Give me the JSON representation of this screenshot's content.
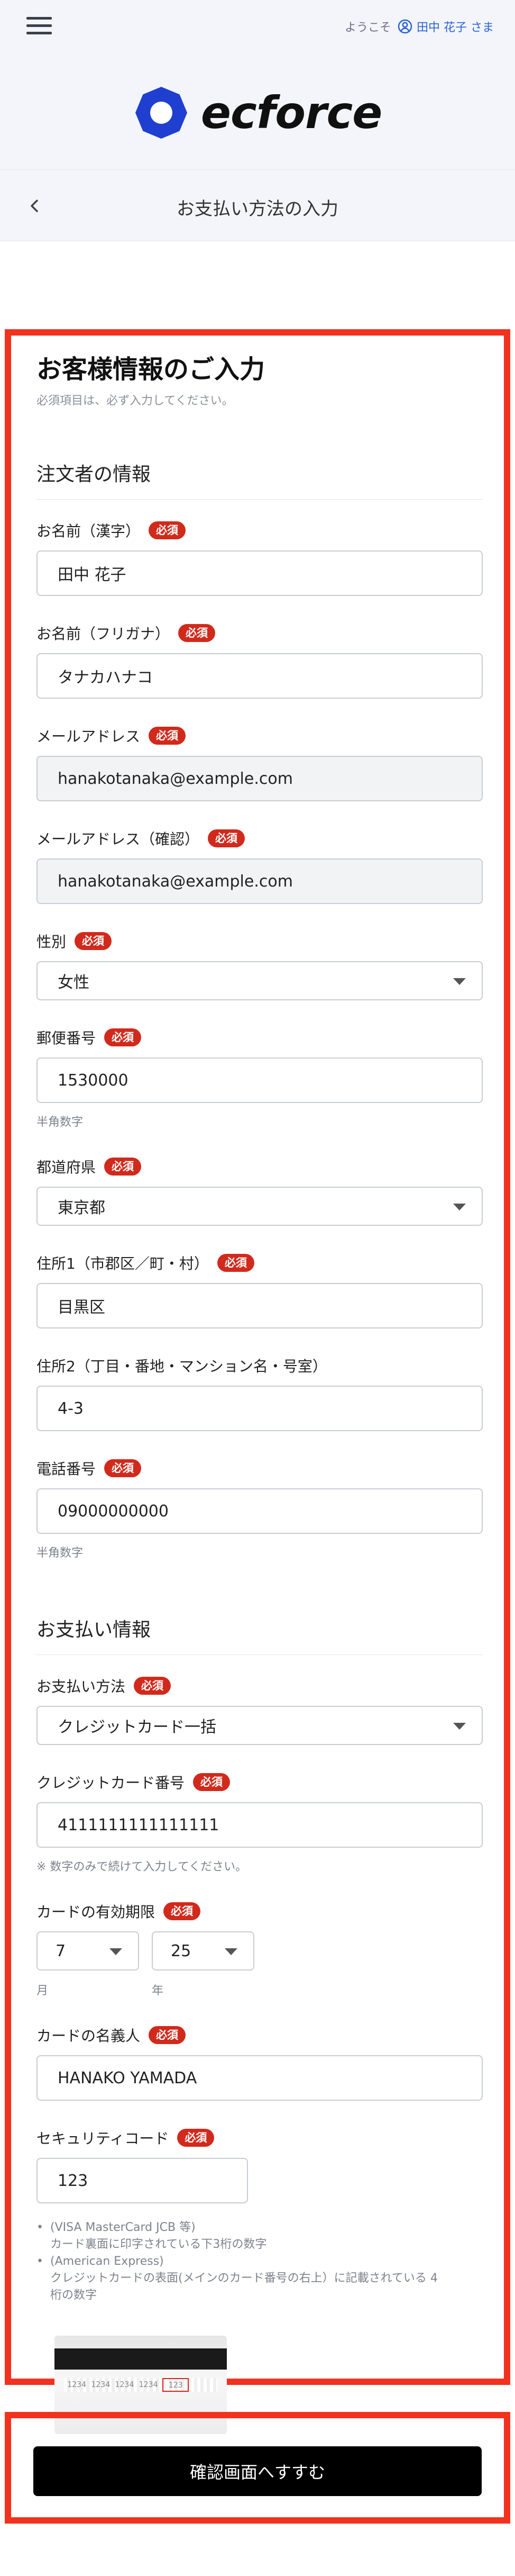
{
  "header": {
    "greeting": "ようこそ",
    "user_name": "田中 花子 さま",
    "logo_text": "ecforce",
    "page_title": "お支払い方法の入力"
  },
  "form": {
    "title": "お客様情報のご入力",
    "note": "必須項目は、必ず入力してください。",
    "required_badge": "必須",
    "orderer_section": "注文者の情報",
    "payment_section": "お支払い情報",
    "fields": {
      "name_kanji": {
        "label": "お名前（漢字）",
        "value": "田中 花子"
      },
      "name_kana": {
        "label": "お名前（フリガナ）",
        "value": "タナカハナコ"
      },
      "email": {
        "label": "メールアドレス",
        "value": "hanakotanaka@example.com"
      },
      "email_confirm": {
        "label": "メールアドレス（確認）",
        "value": "hanakotanaka@example.com"
      },
      "gender": {
        "label": "性別",
        "value": "女性"
      },
      "postal": {
        "label": "郵便番号",
        "value": "1530000",
        "hint": "半角数字"
      },
      "prefecture": {
        "label": "都道府県",
        "value": "東京都"
      },
      "address1": {
        "label": "住所1（市郡区／町・村）",
        "value": "目黒区"
      },
      "address2": {
        "label": "住所2（丁目・番地・マンション名・号室）",
        "value": "4-3"
      },
      "phone": {
        "label": "電話番号",
        "value": "09000000000",
        "hint": "半角数字"
      },
      "payment_method": {
        "label": "お支払い方法",
        "value": "クレジットカード一括"
      },
      "card_number": {
        "label": "クレジットカード番号",
        "value": "4111111111111111",
        "hint": "※ 数字のみで続けて入力してください。"
      },
      "expiry": {
        "label": "カードの有効期限",
        "month": "7",
        "month_unit": "月",
        "year": "25",
        "year_unit": "年"
      },
      "card_holder": {
        "label": "カードの名義人",
        "value": "HANAKO YAMADA"
      },
      "security_code": {
        "label": "セキュリティコード",
        "value": "123"
      }
    },
    "security_notes": [
      "(VISA MasterCard JCB 等)",
      "カード裏面に印字されている下3桁の数字",
      "(American Express)",
      "クレジットカードの表面(メインのカード番号の右上）に記載されている 4",
      "桁の数字"
    ],
    "card_sample": {
      "digits": "1234 1234 1234 1234",
      "cvc": "123"
    }
  },
  "submit_label": "確認画面へすすむ",
  "colors": {
    "accent": "#2a62d8",
    "required": "#d12a1c",
    "highlight_frame": "#f2321e",
    "logo_ring": "#1e3fd0"
  }
}
